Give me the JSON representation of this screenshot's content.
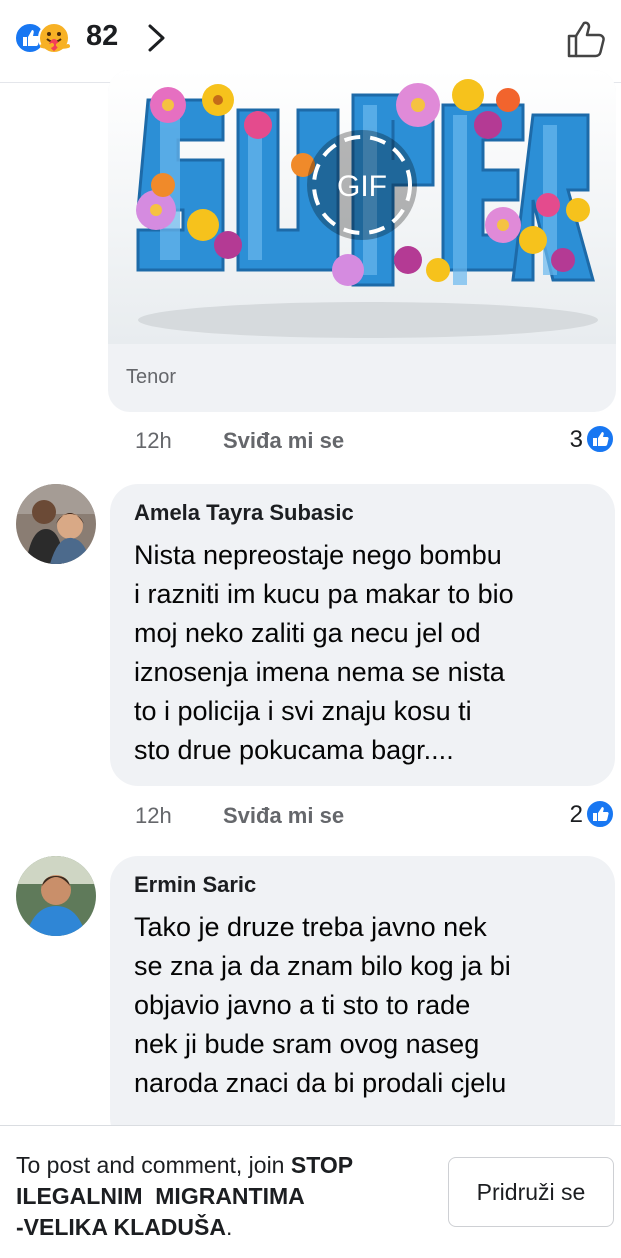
{
  "header": {
    "reaction_count": "82",
    "reaction_types": [
      "like-icon",
      "care-icon"
    ]
  },
  "gif": {
    "badge": "GIF",
    "source": "Tenor",
    "time": "12h",
    "like_label": "Sviđa mi se",
    "like_count": "3"
  },
  "comments": [
    {
      "author": "Amela Tayra Subasic",
      "lines": [
        "Nista nepreostaje nego bombu",
        "i razniti im kucu pa makar to bio",
        "moj neko zaliti ga necu jel od",
        "iznosenja imena nema se nista",
        "to i policija i svi znaju kosu ti",
        "sto drue pokucama bagr...."
      ],
      "time": "12h",
      "like_label": "Sviđa mi se",
      "like_count": "2"
    },
    {
      "author": "Ermin Saric",
      "lines": [
        "Tako je druze treba javno nek",
        "se zna ja da znam bilo kog ja bi",
        "objavio javno a ti sto to rade",
        "nek ji bude sram ovog naseg",
        "naroda znaci da bi prodali cjelu"
      ]
    }
  ],
  "footer": {
    "prefix": "To post and comment, join ",
    "group_line1": "STOP",
    "group_line2": "ILEGALNIM  MIGRANTIMA",
    "group_line3": "-VELIKA KLADUŠA",
    "suffix": ".",
    "join_button": "Pridruži se"
  },
  "colors": {
    "facebook_blue": "#1877f2",
    "bubble_bg": "#f0f2f5",
    "meta_text": "#65676b"
  }
}
